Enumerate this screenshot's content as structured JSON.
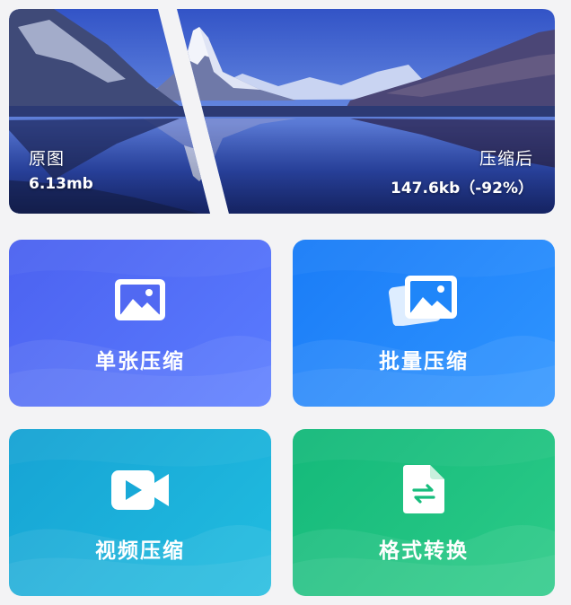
{
  "compare": {
    "original_title": "原图",
    "original_size": "6.13mb",
    "compressed_title": "压缩后",
    "compressed_size": "147.6kb（-92%）"
  },
  "tools": {
    "single": "单张压缩",
    "batch": "批量压缩",
    "video": "视频压缩",
    "format": "格式转换"
  },
  "colors": {
    "page_bg": "#f3f3f5",
    "single": "#4c62f0",
    "batch": "#1a7cf7",
    "video": "#16a3d4",
    "format": "#14b97a"
  },
  "icons": {
    "single": "image-icon",
    "batch": "images-stack-icon",
    "video": "video-camera-icon",
    "format": "file-convert-icon"
  }
}
